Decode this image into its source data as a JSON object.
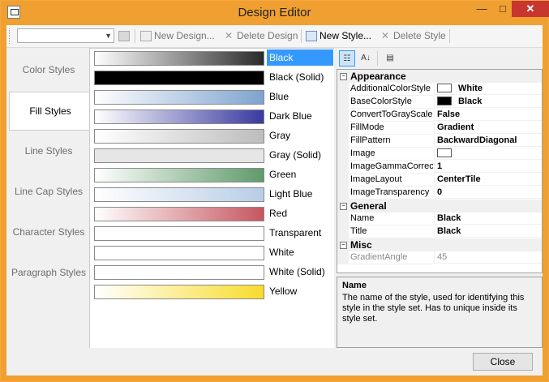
{
  "window": {
    "title": "Design Editor",
    "controls": {
      "minimize": "—",
      "maximize": "□",
      "close": "✕"
    }
  },
  "toolbar": {
    "combo_value": "",
    "new_design": "New Design...",
    "delete_design": "Delete Design",
    "new_style": "New Style...",
    "delete_style": "Delete Style"
  },
  "tabs": [
    "Color Styles",
    "Fill Styles",
    "Line Styles",
    "Line Cap Styles",
    "Character Styles",
    "Paragraph Styles"
  ],
  "active_tab": 1,
  "fill_styles": [
    {
      "name": "Black",
      "c1": "#ffffff",
      "c2": "#2a2a2a",
      "selected": true
    },
    {
      "name": "Black (Solid)",
      "c1": "#000000",
      "c2": "#000000",
      "selected": false
    },
    {
      "name": "Blue",
      "c1": "#ffffff",
      "c2": "#7ea3cf",
      "selected": false
    },
    {
      "name": "Dark Blue",
      "c1": "#ffffff",
      "c2": "#3a3aa0",
      "selected": false
    },
    {
      "name": "Gray",
      "c1": "#ffffff",
      "c2": "#bdbdbd",
      "selected": false
    },
    {
      "name": "Gray (Solid)",
      "c1": "#e6e6e6",
      "c2": "#e6e6e6",
      "selected": false
    },
    {
      "name": "Green",
      "c1": "#ffffff",
      "c2": "#5f9a6a",
      "selected": false
    },
    {
      "name": "Light Blue",
      "c1": "#ffffff",
      "c2": "#b7cde6",
      "selected": false
    },
    {
      "name": "Red",
      "c1": "#ffffff",
      "c2": "#c75660",
      "selected": false
    },
    {
      "name": "Transparent",
      "c1": "#ffffff",
      "c2": "#ffffff",
      "selected": false
    },
    {
      "name": "White",
      "c1": "#ffffff",
      "c2": "#ffffff",
      "selected": false
    },
    {
      "name": "White (Solid)",
      "c1": "#ffffff",
      "c2": "#ffffff",
      "selected": false
    },
    {
      "name": "Yellow",
      "c1": "#ffffff",
      "c2": "#f8dc2c",
      "selected": false
    }
  ],
  "property_grid": {
    "categories": [
      {
        "name": "Appearance",
        "props": [
          {
            "name": "AdditionalColorStyle",
            "value": "White",
            "swatch": "#ffffff",
            "disabled": false
          },
          {
            "name": "BaseColorStyle",
            "value": "Black",
            "swatch": "#000000",
            "disabled": false
          },
          {
            "name": "ConvertToGrayScale",
            "value": "False",
            "disabled": false
          },
          {
            "name": "FillMode",
            "value": "Gradient",
            "disabled": false
          },
          {
            "name": "FillPattern",
            "value": "BackwardDiagonal",
            "disabled": false
          },
          {
            "name": "Image",
            "value": "",
            "swatch": "#ffffff",
            "disabled": false
          },
          {
            "name": "ImageGammaCorrect",
            "value": "1",
            "disabled": false
          },
          {
            "name": "ImageLayout",
            "value": "CenterTile",
            "disabled": false
          },
          {
            "name": "ImageTransparency",
            "value": "0",
            "disabled": false
          }
        ]
      },
      {
        "name": "General",
        "props": [
          {
            "name": "Name",
            "value": "Black",
            "disabled": false
          },
          {
            "name": "Title",
            "value": "Black",
            "disabled": false
          }
        ]
      },
      {
        "name": "Misc",
        "props": [
          {
            "name": "GradientAngle",
            "value": "45",
            "disabled": true
          }
        ]
      }
    ]
  },
  "description": {
    "title": "Name",
    "text": "The name of the style, used for identifying this style in the style set. Has to unique inside its style set."
  },
  "footer": {
    "close_label": "Close"
  },
  "colors": {
    "titlebar": "#f0a030",
    "selection": "#3399ff"
  }
}
